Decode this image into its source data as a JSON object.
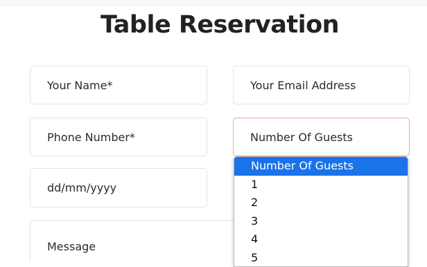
{
  "form": {
    "title": "Table Reservation",
    "name_placeholder": "Your Name*",
    "email_placeholder": "Your Email Address",
    "phone_placeholder": "Phone Number*",
    "guests_selected": "Number Of Guests",
    "date_placeholder": "dd/mm/yyyy",
    "message_placeholder": "Message"
  },
  "guests_dropdown": {
    "options": [
      "Number Of Guests",
      "1",
      "2",
      "3",
      "4",
      "5"
    ],
    "selected_index": 0
  },
  "colors": {
    "accent": "#1a73e8",
    "active_border": "#e8a4a4",
    "field_border": "#e3e3e3",
    "title_text": "#222222"
  }
}
